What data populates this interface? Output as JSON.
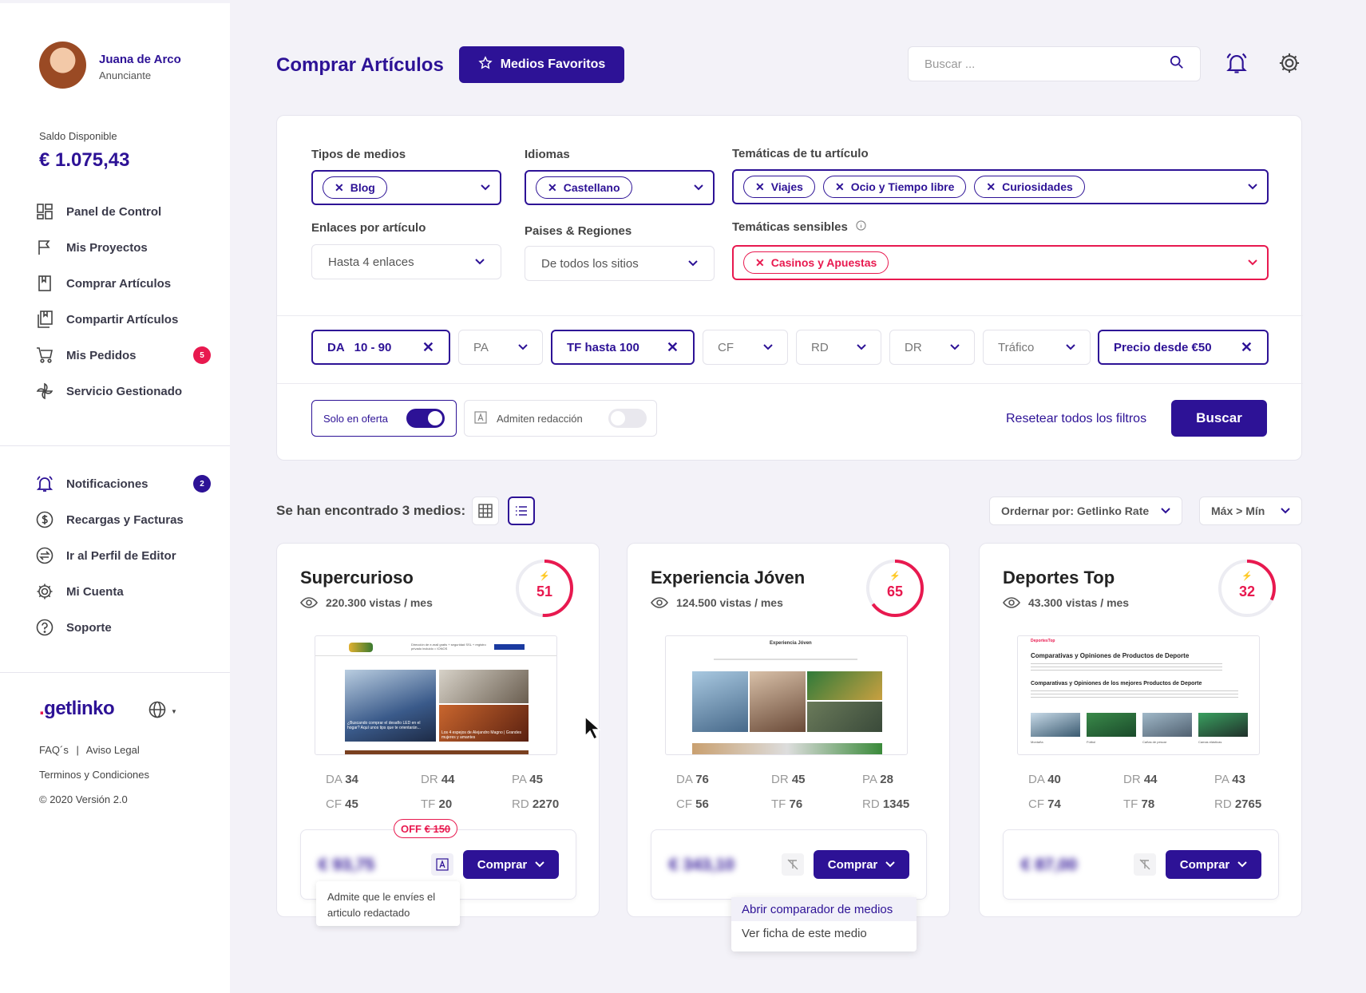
{
  "user": {
    "name": "Juana de Arco",
    "role": "Anunciante"
  },
  "balance": {
    "label": "Saldo Disponible",
    "value": "€ 1.075,43"
  },
  "nav": [
    {
      "label": "Panel de Control",
      "icon": "dashboard-icon"
    },
    {
      "label": "Mis Proyectos",
      "icon": "flag-icon"
    },
    {
      "label": "Comprar Artículos",
      "icon": "bookmark-icon"
    },
    {
      "label": "Compartir Artículos",
      "icon": "share-docs-icon"
    },
    {
      "label": "Mis Pedidos",
      "icon": "cart-icon",
      "badge": "5"
    },
    {
      "label": "Servicio Gestionado",
      "icon": "pinwheel-icon"
    }
  ],
  "nav2": [
    {
      "label": "Notificaciones",
      "icon": "bell-icon",
      "badge": "2"
    },
    {
      "label": "Recargas y Facturas",
      "icon": "dollar-icon"
    },
    {
      "label": "Ir al Perfil de Editor",
      "icon": "switch-icon"
    },
    {
      "label": "Mi Cuenta",
      "icon": "gear-icon"
    },
    {
      "label": "Soporte",
      "icon": "help-icon"
    }
  ],
  "footer": {
    "logo": "getlinko",
    "faq": "FAQ´s",
    "legal": "Aviso Legal",
    "terms": "Terminos y Condiciones",
    "version": "© 2020 Versión 2.0"
  },
  "header": {
    "title": "Comprar Artículos",
    "fav_button": "Medios Favoritos",
    "search_placeholder": "Buscar ..."
  },
  "filters": {
    "media_types": {
      "label": "Tipos de medios",
      "chips": [
        "Blog"
      ]
    },
    "languages": {
      "label": "Idiomas",
      "chips": [
        "Castellano"
      ]
    },
    "topics": {
      "label": "Temáticas de tu artículo",
      "chips": [
        "Viajes",
        "Ocio y Tiempo libre",
        "Curiosidades"
      ]
    },
    "links": {
      "label": "Enlaces por artículo",
      "value": "Hasta 4 enlaces"
    },
    "countries": {
      "label": "Paises & Regiones",
      "value": "De todos los sitios"
    },
    "sensitive": {
      "label": "Temáticas sensibles",
      "chips": [
        "Casinos y Apuestas"
      ]
    },
    "metrics": {
      "da": "DA   10 - 90",
      "pa": "PA",
      "tf": "TF hasta 100",
      "cf": "CF",
      "rd": "RD",
      "dr": "DR",
      "traffic": "Tráfico",
      "price": "Precio desde €50"
    },
    "only_offer": {
      "label": "Solo en oferta",
      "on": true
    },
    "writing": {
      "label": "Admiten redacción",
      "on": false
    },
    "reset": "Resetear todos los filtros",
    "search_btn": "Buscar"
  },
  "results": {
    "found": "Se han encontrado 3 medios:",
    "order": "Ordernar por: Getlinko Rate",
    "dir": "Máx > Mín"
  },
  "cards": [
    {
      "name": "Supercurioso",
      "views": "220.300 vistas / mes",
      "rate": "51",
      "rate_value": 51,
      "da": "34",
      "dr": "44",
      "pa": "45",
      "cf": "45",
      "tf": "20",
      "rd": "2270",
      "price": "€ 93,75",
      "buy": "Comprar"
    },
    {
      "name": "Experiencia Jóven",
      "views": "124.500 vistas / mes",
      "rate": "65",
      "rate_value": 65,
      "da": "76",
      "dr": "45",
      "pa": "28",
      "cf": "56",
      "tf": "76",
      "rd": "1345",
      "price": "€ 343,10",
      "buy": "Comprar"
    },
    {
      "name": "Deportes Top",
      "views": "43.300 vistas / mes",
      "rate": "32",
      "rate_value": 32,
      "da": "40",
      "dr": "44",
      "pa": "43",
      "cf": "74",
      "tf": "78",
      "rd": "2765",
      "price": "€ 87,00",
      "buy": "Comprar"
    }
  ],
  "offer_badge": {
    "prefix": "OFF",
    "old": "€ 150"
  },
  "tooltip": "Admite que le envíes el articulo redactado",
  "dropdown": [
    "Abrir comparador de medios",
    "Ver ficha de este medio"
  ],
  "thumbs": {
    "t1_header": "Dirección de e-mail gratis + seguridad SSL + registro privado incluido = IONOS",
    "t1_cap1": "¿Buscando comprar el desafío LED en el hogar? Aquí unos tips que te orientarán...",
    "t1_cap2": "Los 4 espejos de Alejandro Magno | Grandes mujeres y amantes",
    "t2_logo": "Experiencia Jóven",
    "t3_logo": "DeportesTop",
    "t3_title": "Comparativas y Opiniones de Productos de Deporte",
    "t3_sub": "Comparativas y Opiniones de los mejores Productos de Deporte",
    "t3_labels": [
      "Montaña",
      "Fútbol",
      "Cañas de pescar",
      "Camas elásticas"
    ]
  },
  "colors": {
    "primary": "#2d1296",
    "accent": "#e8194f"
  }
}
